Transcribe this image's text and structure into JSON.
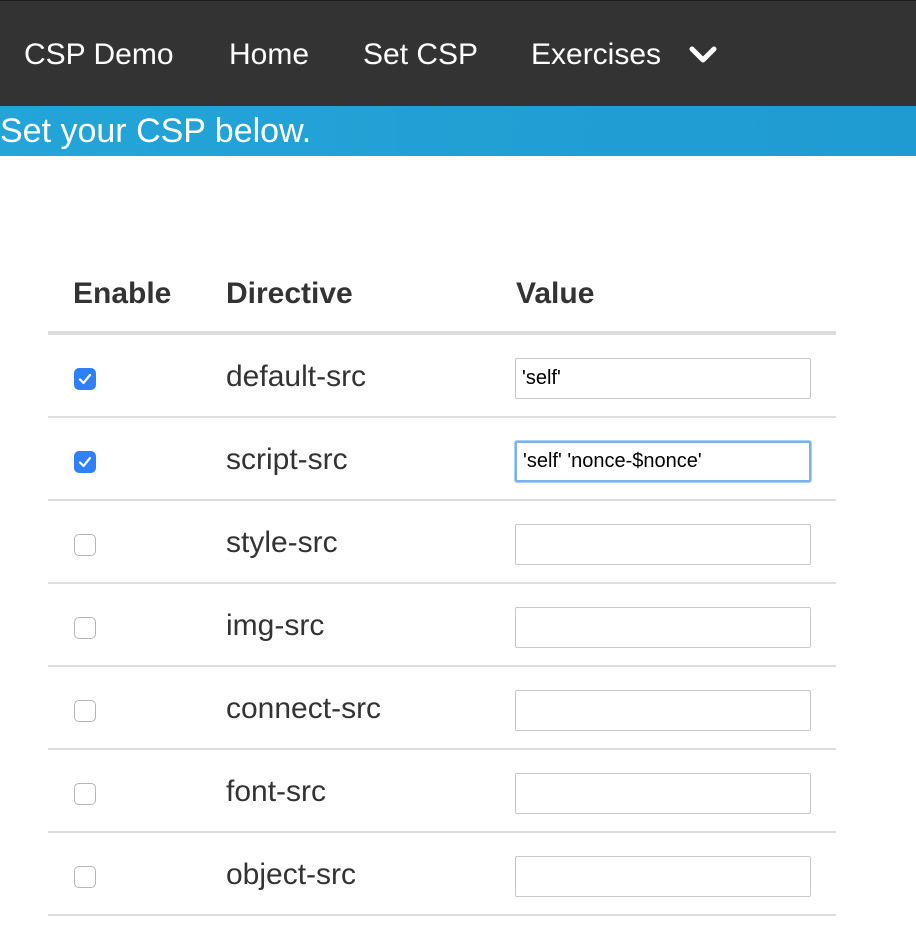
{
  "nav": {
    "brand": "CSP Demo",
    "home": "Home",
    "set_csp": "Set CSP",
    "exercises": "Exercises",
    "exercises_icon": "chevron-down-icon"
  },
  "banner": {
    "text": "Set your CSP below."
  },
  "table": {
    "headers": {
      "enable": "Enable",
      "directive": "Directive",
      "value": "Value"
    },
    "rows": [
      {
        "directive": "default-src",
        "enabled": true,
        "value": "'self'"
      },
      {
        "directive": "script-src",
        "enabled": true,
        "value": "'self' 'nonce-$nonce'"
      },
      {
        "directive": "style-src",
        "enabled": false,
        "value": ""
      },
      {
        "directive": "img-src",
        "enabled": false,
        "value": ""
      },
      {
        "directive": "connect-src",
        "enabled": false,
        "value": ""
      },
      {
        "directive": "font-src",
        "enabled": false,
        "value": ""
      },
      {
        "directive": "object-src",
        "enabled": false,
        "value": ""
      }
    ]
  },
  "colors": {
    "navbar_bg": "#333333",
    "banner_bg": "#1f9bd1",
    "checkbox_checked": "#2f7ff7",
    "focus_ring": "#7ab3ec"
  }
}
